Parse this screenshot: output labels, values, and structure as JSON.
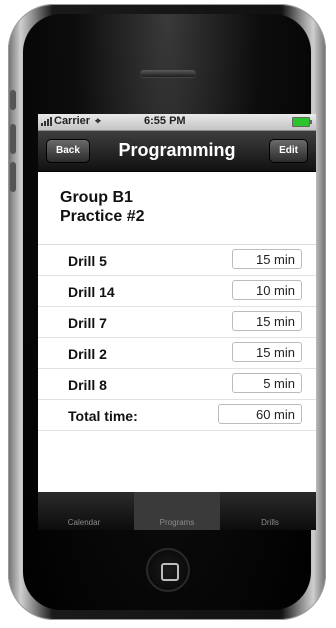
{
  "statusbar": {
    "carrier": "Carrier",
    "time": "6:55 PM",
    "wifi_icon": "wifi-icon"
  },
  "navbar": {
    "back": "Back",
    "title": "Programming",
    "edit": "Edit"
  },
  "group": {
    "line1": "Group B1",
    "line2": "Practice #2"
  },
  "drills": [
    {
      "name": "Drill 5",
      "time": "15 min"
    },
    {
      "name": "Drill 14",
      "time": "10 min"
    },
    {
      "name": "Drill 7",
      "time": "15 min"
    },
    {
      "name": "Drill 2",
      "time": "15 min"
    },
    {
      "name": "Drill 8",
      "time": "5 min"
    }
  ],
  "total": {
    "label": "Total time:",
    "time": "60 min"
  },
  "tabs": [
    "Calendar",
    "Programs",
    "Drills"
  ],
  "colors": {
    "battery": "#2bc42b",
    "navbar": "#1e1e1e",
    "tabbar": "#0c0c0c"
  }
}
